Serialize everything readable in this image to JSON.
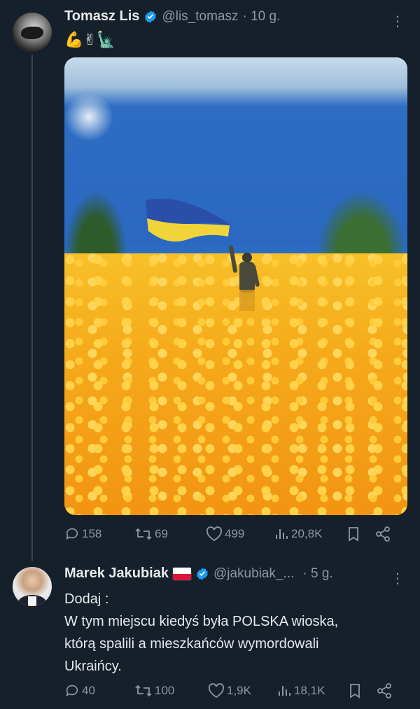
{
  "tweet1": {
    "author_name": "Tomasz Lis",
    "handle": "@lis_tomasz",
    "time": "· 10 g.",
    "text": "💪✌🗽",
    "stats": {
      "replies": "158",
      "retweets": "69",
      "likes": "499",
      "views": "20,8K"
    }
  },
  "tweet2": {
    "author_name": "Marek Jakubiak",
    "handle": "@jakubiak_...",
    "time": "· 5 g.",
    "text": "Dodaj :\nW tym miejscu kiedyś była POLSKA wioska,\nktórą spalili  a mieszkańców wymordowali\nUkraińcy.",
    "stats": {
      "replies": "40",
      "retweets": "100",
      "likes": "1,9K",
      "views": "18,1K"
    }
  },
  "colors": {
    "background": "#15202b",
    "text_primary": "#e7e9ea",
    "text_secondary": "#8b98a5",
    "verified": "#1d9bf0"
  },
  "icons": [
    "verified-icon",
    "more-icon",
    "reply-icon",
    "retweet-icon",
    "like-icon",
    "views-icon",
    "bookmark-icon",
    "share-icon"
  ]
}
